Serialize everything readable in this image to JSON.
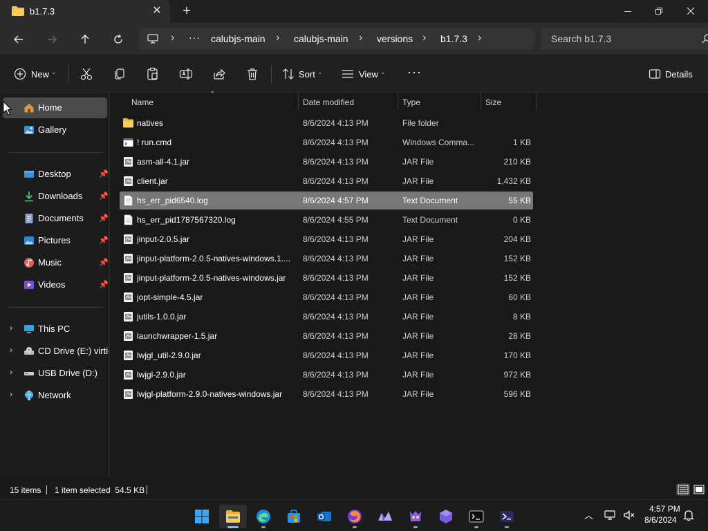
{
  "window": {
    "tab_title": "b1.7.3",
    "tab_close": "✕",
    "new_tab": "+"
  },
  "nav": {
    "breadcrumb_items": [
      "calubjs-main",
      "calubjs-main",
      "versions",
      "b1.7.3"
    ],
    "overflow": "···",
    "search_placeholder": "Search b1.7.3"
  },
  "toolbar": {
    "new_label": "New",
    "sort_label": "Sort",
    "view_label": "View",
    "more": "···",
    "details_label": "Details"
  },
  "sidebar": {
    "quick": [
      {
        "label": "Home",
        "icon": "home-icon",
        "selected": true
      },
      {
        "label": "Gallery",
        "icon": "gallery-icon"
      }
    ],
    "pinned": [
      {
        "label": "Desktop",
        "icon": "desktop-icon"
      },
      {
        "label": "Downloads",
        "icon": "downloads-icon"
      },
      {
        "label": "Documents",
        "icon": "documents-icon"
      },
      {
        "label": "Pictures",
        "icon": "pictures-icon"
      },
      {
        "label": "Music",
        "icon": "music-icon"
      },
      {
        "label": "Videos",
        "icon": "videos-icon"
      }
    ],
    "drives": [
      {
        "label": "This PC",
        "icon": "this-pc-icon"
      },
      {
        "label": "CD Drive (E:) virtio-",
        "icon": "cd-drive-icon"
      },
      {
        "label": "USB Drive (D:)",
        "icon": "usb-drive-icon"
      },
      {
        "label": "Network",
        "icon": "network-icon"
      }
    ]
  },
  "columns": {
    "name": "Name",
    "date": "Date modified",
    "type": "Type",
    "size": "Size"
  },
  "files": [
    {
      "name": "natives",
      "date": "8/6/2024 4:13 PM",
      "type": "File folder",
      "size": "",
      "icon": "folder-icon"
    },
    {
      "name": "! run.cmd",
      "date": "8/6/2024 4:13 PM",
      "type": "Windows Comma...",
      "size": "1 KB",
      "icon": "cmd-file-icon"
    },
    {
      "name": "asm-all-4.1.jar",
      "date": "8/6/2024 4:13 PM",
      "type": "JAR File",
      "size": "210 KB",
      "icon": "jar-file-icon"
    },
    {
      "name": "client.jar",
      "date": "8/6/2024 4:13 PM",
      "type": "JAR File",
      "size": "1,432 KB",
      "icon": "jar-file-icon"
    },
    {
      "name": "hs_err_pid6540.log",
      "date": "8/6/2024 4:57 PM",
      "type": "Text Document",
      "size": "55 KB",
      "icon": "text-file-icon",
      "selected": true
    },
    {
      "name": "hs_err_pid1787567320.log",
      "date": "8/6/2024 4:55 PM",
      "type": "Text Document",
      "size": "0 KB",
      "icon": "text-file-icon"
    },
    {
      "name": "jinput-2.0.5.jar",
      "date": "8/6/2024 4:13 PM",
      "type": "JAR File",
      "size": "204 KB",
      "icon": "jar-file-icon"
    },
    {
      "name": "jinput-platform-2.0.5-natives-windows.1....",
      "date": "8/6/2024 4:13 PM",
      "type": "JAR File",
      "size": "152 KB",
      "icon": "jar-file-icon"
    },
    {
      "name": "jinput-platform-2.0.5-natives-windows.jar",
      "date": "8/6/2024 4:13 PM",
      "type": "JAR File",
      "size": "152 KB",
      "icon": "jar-file-icon"
    },
    {
      "name": "jopt-simple-4.5.jar",
      "date": "8/6/2024 4:13 PM",
      "type": "JAR File",
      "size": "60 KB",
      "icon": "jar-file-icon"
    },
    {
      "name": "jutils-1.0.0.jar",
      "date": "8/6/2024 4:13 PM",
      "type": "JAR File",
      "size": "8 KB",
      "icon": "jar-file-icon"
    },
    {
      "name": "launchwrapper-1.5.jar",
      "date": "8/6/2024 4:13 PM",
      "type": "JAR File",
      "size": "28 KB",
      "icon": "jar-file-icon"
    },
    {
      "name": "lwjgl_util-2.9.0.jar",
      "date": "8/6/2024 4:13 PM",
      "type": "JAR File",
      "size": "170 KB",
      "icon": "jar-file-icon"
    },
    {
      "name": "lwjgl-2.9.0.jar",
      "date": "8/6/2024 4:13 PM",
      "type": "JAR File",
      "size": "972 KB",
      "icon": "jar-file-icon"
    },
    {
      "name": "lwjgl-platform-2.9.0-natives-windows.jar",
      "date": "8/6/2024 4:13 PM",
      "type": "JAR File",
      "size": "596 KB",
      "icon": "jar-file-icon"
    }
  ],
  "status": {
    "item_count": "15 items",
    "selection": "1 item selected  54.5 KB"
  },
  "taskbar": {
    "apps": [
      {
        "name": "start-button",
        "active": false,
        "running": false
      },
      {
        "name": "file-explorer",
        "active": true,
        "running": true
      },
      {
        "name": "edge",
        "active": false,
        "running": true
      },
      {
        "name": "microsoft-store",
        "active": false,
        "running": false
      },
      {
        "name": "outlook",
        "active": false,
        "running": false
      },
      {
        "name": "firefox",
        "active": false,
        "running": true
      },
      {
        "name": "app-7",
        "active": false,
        "running": false
      },
      {
        "name": "app-8",
        "active": false,
        "running": true
      },
      {
        "name": "app-9",
        "active": false,
        "running": false
      },
      {
        "name": "terminal",
        "active": false,
        "running": true
      },
      {
        "name": "powershell",
        "active": false,
        "running": true
      }
    ],
    "time": "4:57 PM",
    "date": "8/6/2024"
  },
  "colors": {
    "accent": "#60cdff",
    "folder": "#f3c043",
    "selection": "#777777"
  }
}
